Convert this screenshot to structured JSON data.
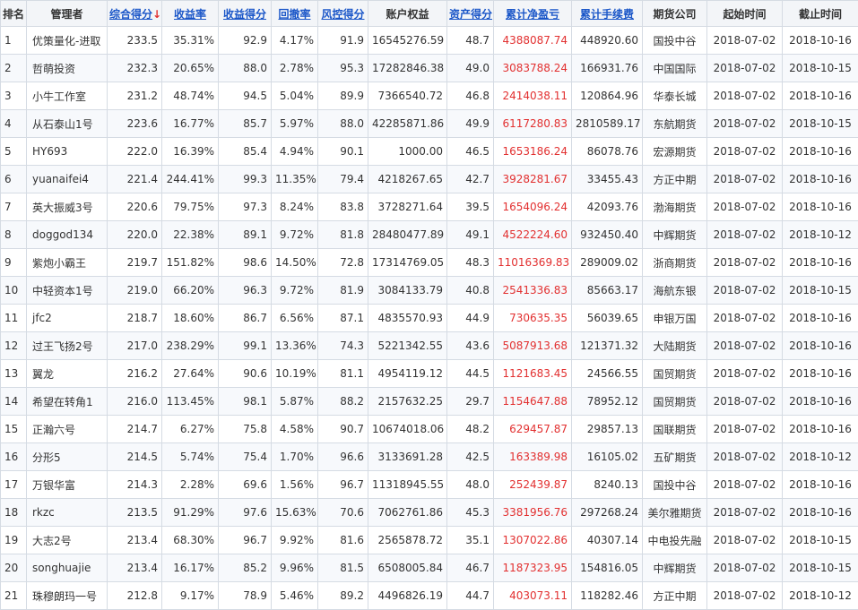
{
  "headers": [
    {
      "label": "排名",
      "sortable": false
    },
    {
      "label": "管理者",
      "sortable": false
    },
    {
      "label": "综合得分",
      "sortable": true,
      "arrow": "↓"
    },
    {
      "label": "收益率",
      "sortable": true
    },
    {
      "label": "收益得分",
      "sortable": true
    },
    {
      "label": "回撤率",
      "sortable": true
    },
    {
      "label": "风控得分",
      "sortable": true
    },
    {
      "label": "账户权益",
      "sortable": false
    },
    {
      "label": "资产得分",
      "sortable": true
    },
    {
      "label": "累计净盈亏",
      "sortable": true
    },
    {
      "label": "累计手续费",
      "sortable": true
    },
    {
      "label": "期货公司",
      "sortable": false
    },
    {
      "label": "起始时间",
      "sortable": false
    },
    {
      "label": "截止时间",
      "sortable": false
    }
  ],
  "accent_red": "#e23030",
  "link_blue": "#1a56c8",
  "rows": [
    [
      "1",
      "优策量化-进取",
      "233.5",
      "35.31%",
      "92.9",
      "4.17%",
      "91.9",
      "16545276.59",
      "48.7",
      "4388087.74",
      "448920.60",
      "国投中谷",
      "2018-07-02",
      "2018-10-16"
    ],
    [
      "2",
      "哲萌投资",
      "232.3",
      "20.65%",
      "88.0",
      "2.78%",
      "95.3",
      "17282846.38",
      "49.0",
      "3083788.24",
      "166931.76",
      "中国国际",
      "2018-07-02",
      "2018-10-15"
    ],
    [
      "3",
      "小牛工作室",
      "231.2",
      "48.74%",
      "94.5",
      "5.04%",
      "89.9",
      "7366540.72",
      "46.8",
      "2414038.11",
      "120864.96",
      "华泰长城",
      "2018-07-02",
      "2018-10-16"
    ],
    [
      "4",
      "从石泰山1号",
      "223.6",
      "16.77%",
      "85.7",
      "5.97%",
      "88.0",
      "42285871.86",
      "49.9",
      "6117280.83",
      "2810589.17",
      "东航期货",
      "2018-07-02",
      "2018-10-15"
    ],
    [
      "5",
      "HY693",
      "222.0",
      "16.39%",
      "85.4",
      "4.94%",
      "90.1",
      "1000.00",
      "46.5",
      "1653186.24",
      "86078.76",
      "宏源期货",
      "2018-07-02",
      "2018-10-16"
    ],
    [
      "6",
      "yuanaifei4",
      "221.4",
      "244.41%",
      "99.3",
      "11.35%",
      "79.4",
      "4218267.65",
      "42.7",
      "3928281.67",
      "33455.43",
      "方正中期",
      "2018-07-02",
      "2018-10-16"
    ],
    [
      "7",
      "英大振威3号",
      "220.6",
      "79.75%",
      "97.3",
      "8.24%",
      "83.8",
      "3728271.64",
      "39.5",
      "1654096.24",
      "42093.76",
      "渤海期货",
      "2018-07-02",
      "2018-10-16"
    ],
    [
      "8",
      "doggod134",
      "220.0",
      "22.38%",
      "89.1",
      "9.72%",
      "81.8",
      "28480477.89",
      "49.1",
      "4522224.60",
      "932450.40",
      "中辉期货",
      "2018-07-02",
      "2018-10-12"
    ],
    [
      "9",
      "紫炮小霸王",
      "219.7",
      "151.82%",
      "98.6",
      "14.50%",
      "72.8",
      "17314769.05",
      "48.3",
      "11016369.83",
      "289009.02",
      "浙商期货",
      "2018-07-02",
      "2018-10-16"
    ],
    [
      "10",
      "中轻资本1号",
      "219.0",
      "66.20%",
      "96.3",
      "9.72%",
      "81.9",
      "3084133.79",
      "40.8",
      "2541336.83",
      "85663.17",
      "海航东银",
      "2018-07-02",
      "2018-10-15"
    ],
    [
      "11",
      "jfc2",
      "218.7",
      "18.60%",
      "86.7",
      "6.56%",
      "87.1",
      "4835570.93",
      "44.9",
      "730635.35",
      "56039.65",
      "申银万国",
      "2018-07-02",
      "2018-10-16"
    ],
    [
      "12",
      "过王飞扬2号",
      "217.0",
      "238.29%",
      "99.1",
      "13.36%",
      "74.3",
      "5221342.55",
      "43.6",
      "5087913.68",
      "121371.32",
      "大陆期货",
      "2018-07-02",
      "2018-10-16"
    ],
    [
      "13",
      "翼龙",
      "216.2",
      "27.64%",
      "90.6",
      "10.19%",
      "81.1",
      "4954119.12",
      "44.5",
      "1121683.45",
      "24566.55",
      "国贸期货",
      "2018-07-02",
      "2018-10-16"
    ],
    [
      "14",
      "希望在转角1",
      "216.0",
      "113.45%",
      "98.1",
      "5.87%",
      "88.2",
      "2157632.25",
      "29.7",
      "1154647.88",
      "78952.12",
      "国贸期货",
      "2018-07-02",
      "2018-10-16"
    ],
    [
      "15",
      "正瀚六号",
      "214.7",
      "6.27%",
      "75.8",
      "4.58%",
      "90.7",
      "10674018.06",
      "48.2",
      "629457.87",
      "29857.13",
      "国联期货",
      "2018-07-02",
      "2018-10-16"
    ],
    [
      "16",
      "分形5",
      "214.5",
      "5.74%",
      "75.4",
      "1.70%",
      "96.6",
      "3133691.28",
      "42.5",
      "163389.98",
      "16105.02",
      "五矿期货",
      "2018-07-02",
      "2018-10-12"
    ],
    [
      "17",
      "万银华富",
      "214.3",
      "2.28%",
      "69.6",
      "1.56%",
      "96.7",
      "11318945.55",
      "48.0",
      "252439.87",
      "8240.13",
      "国投中谷",
      "2018-07-02",
      "2018-10-16"
    ],
    [
      "18",
      "rkzc",
      "213.5",
      "91.29%",
      "97.6",
      "15.63%",
      "70.6",
      "7062761.86",
      "45.3",
      "3381956.76",
      "297268.24",
      "美尔雅期货",
      "2018-07-02",
      "2018-10-16"
    ],
    [
      "19",
      "大志2号",
      "213.4",
      "68.30%",
      "96.7",
      "9.92%",
      "81.6",
      "2565878.72",
      "35.1",
      "1307022.86",
      "40307.14",
      "中电投先融",
      "2018-07-02",
      "2018-10-15"
    ],
    [
      "20",
      "songhuajie",
      "213.4",
      "16.17%",
      "85.2",
      "9.96%",
      "81.5",
      "6508005.84",
      "46.7",
      "1187323.95",
      "154816.05",
      "中辉期货",
      "2018-07-02",
      "2018-10-15"
    ],
    [
      "21",
      "珠穆朗玛一号",
      "212.8",
      "9.17%",
      "78.9",
      "5.46%",
      "89.2",
      "4496826.19",
      "44.7",
      "403073.11",
      "118282.46",
      "方正中期",
      "2018-07-02",
      "2018-10-12"
    ]
  ]
}
